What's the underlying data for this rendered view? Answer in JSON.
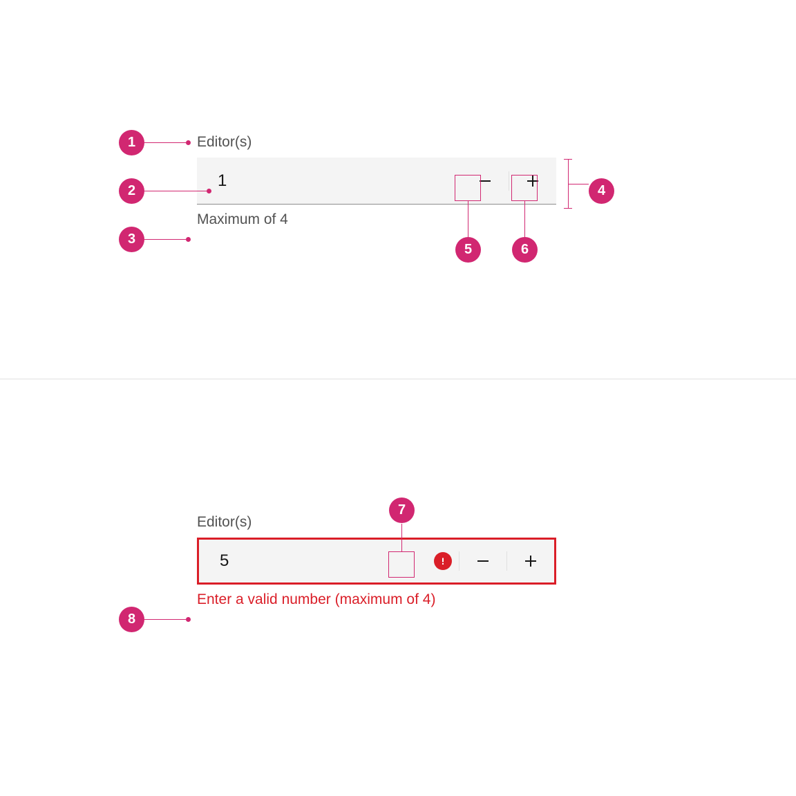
{
  "colors": {
    "accent_pink": "#d12771",
    "error_red": "#da1e28",
    "field_bg": "#f4f4f4",
    "text_secondary": "#525252",
    "text_primary": "#161616"
  },
  "annotations": {
    "1": "1",
    "2": "2",
    "3": "3",
    "4": "4",
    "5": "5",
    "6": "6",
    "7": "7",
    "8": "8"
  },
  "example_default": {
    "label": "Editor(s)",
    "value": "1",
    "helper": "Maximum of 4"
  },
  "example_error": {
    "label": "Editor(s)",
    "value": "5",
    "helper": "Enter a valid number (maximum of 4)"
  }
}
